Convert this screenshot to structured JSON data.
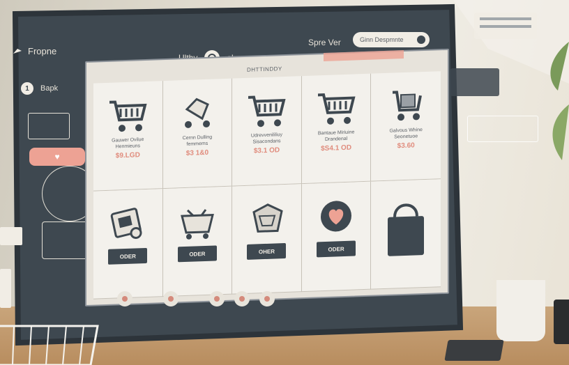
{
  "header": {
    "brand": "Fropne",
    "nav_mid_left": "Ulthy",
    "nav_mid_right": "oluoor",
    "nav_right": "Spre  Ver",
    "search_placeholder": "Ginn  Despmnte"
  },
  "sidebar": {
    "item_num": "1",
    "item_label": "Bapk"
  },
  "panel": {
    "title": "DHTTINDDY"
  },
  "products_top": [
    {
      "name": "Gauwer Ovilue\nHenmieuns",
      "price": "$9.LGD"
    },
    {
      "name": "Cernn Dulling\nfemmems",
      "price": "$3 1&0"
    },
    {
      "name": "Udrevvenililiuy\nSisacondans",
      "price": "$3.1  OD"
    },
    {
      "name": "Bantaue Miriuine\nDrandenal",
      "price": "$S4.1 OD"
    },
    {
      "name": "Galvous Whine\nSeonetuoe",
      "price": "$3.60"
    }
  ],
  "products_bottom": [
    {
      "button": "ODER"
    },
    {
      "button": "ODER"
    },
    {
      "button": "OHER"
    },
    {
      "button": "ODER"
    },
    {
      "button": ""
    }
  ],
  "colors": {
    "frame": "#3e4850",
    "screen_bg": "#e7e3db",
    "accent": "#eda294",
    "price": "#e08c7d"
  }
}
